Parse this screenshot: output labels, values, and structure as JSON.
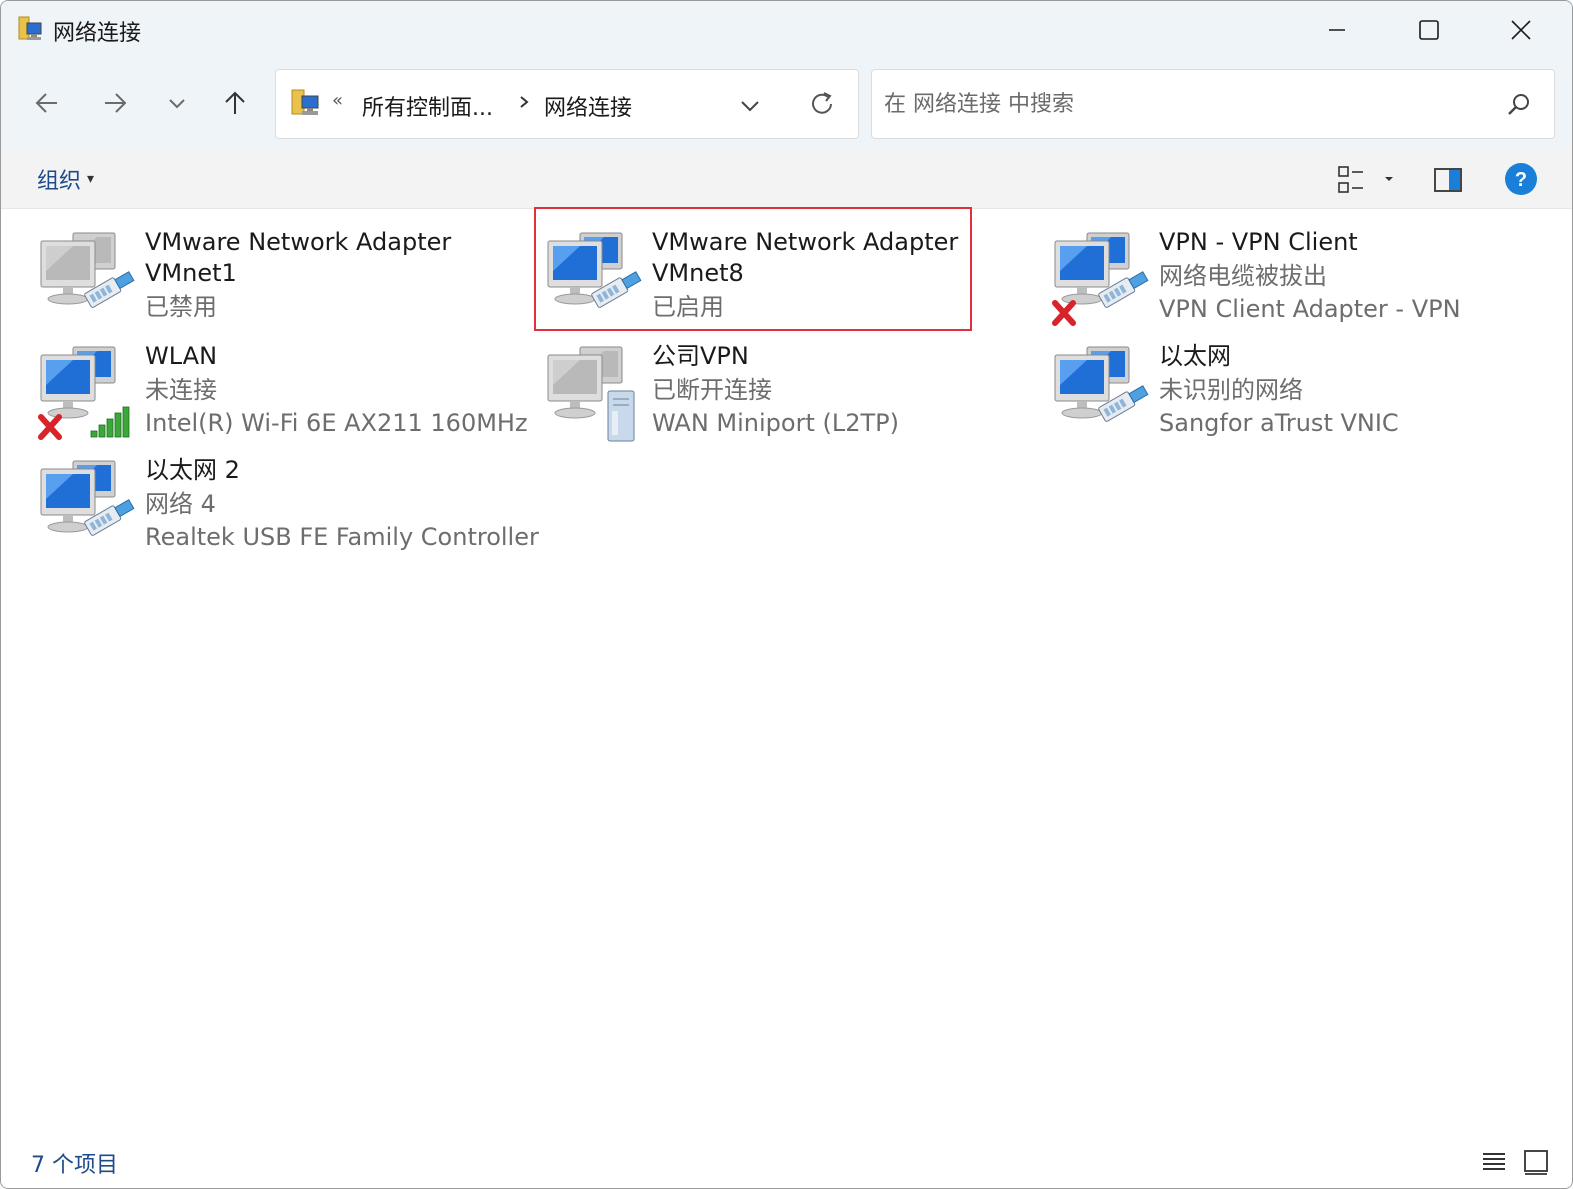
{
  "window": {
    "title": "网络连接",
    "minimize_icon": "minimize-icon",
    "maximize_icon": "maximize-icon",
    "close_icon": "close-icon"
  },
  "nav": {
    "address_collapsed": "«",
    "address_segments": [
      "所有控制面...",
      "网络连接"
    ],
    "search_placeholder": "在 网络连接 中搜索"
  },
  "toolbar": {
    "organize_label": "组织",
    "organize_arrow": "▾"
  },
  "items": [
    {
      "name": "VMware Network Adapter\nVMnet1",
      "lines": [
        "已禁用"
      ],
      "icon": "network-adapter-disabled",
      "selected": false
    },
    {
      "name": "VMware Network Adapter\nVMnet8",
      "lines": [
        "已启用"
      ],
      "icon": "network-adapter-enabled",
      "selected": true
    },
    {
      "name": "VPN - VPN Client",
      "lines": [
        "网络电缆被拔出",
        "VPN Client Adapter - VPN"
      ],
      "icon": "network-adapter-unplugged",
      "selected": false
    },
    {
      "name": "WLAN",
      "lines": [
        "未连接",
        "Intel(R) Wi-Fi 6E AX211 160MHz"
      ],
      "icon": "wifi-disconnected",
      "selected": false
    },
    {
      "name": "公司VPN",
      "lines": [
        "已断开连接",
        "WAN Miniport (L2TP)"
      ],
      "icon": "vpn-disconnected",
      "selected": false
    },
    {
      "name": "以太网",
      "lines": [
        "未识别的网络",
        "Sangfor aTrust VNIC"
      ],
      "icon": "ethernet-adapter",
      "selected": false
    },
    {
      "name": "以太网 2",
      "lines": [
        "网络 4",
        "Realtek USB FE Family Controller"
      ],
      "icon": "ethernet-adapter",
      "selected": false
    }
  ],
  "status": {
    "item_count": "7 个项目"
  },
  "colors": {
    "accent": "#1c4a8a",
    "selection_border": "#e0303a",
    "titlebar_bg": "#eff4f9",
    "help_blue": "#1a7fd8",
    "error_red": "#d8232a"
  }
}
